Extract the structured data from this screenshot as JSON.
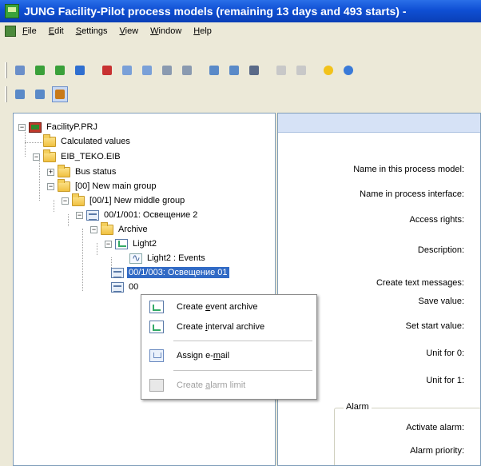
{
  "window": {
    "title": "JUNG Facility-Pilot process models (remaining 13 days and 493 starts) -",
    "icon": "app-icon"
  },
  "menu": {
    "items": [
      {
        "label": "File",
        "underline": "F",
        "rest": "ile"
      },
      {
        "label": "Edit",
        "underline": "E",
        "rest": "dit"
      },
      {
        "label": "Settings",
        "underline": "S",
        "rest": "ettings"
      },
      {
        "label": "View",
        "underline": "V",
        "rest": "iew"
      },
      {
        "label": "Window",
        "underline": "W",
        "rest": "indow"
      },
      {
        "label": "Help",
        "underline": "H",
        "rest": "elp"
      }
    ]
  },
  "toolbar1": {
    "buttons": [
      {
        "name": "properties-icon",
        "color": "#6b8fc9"
      },
      {
        "name": "flag-green-icon",
        "color": "#3aa03a"
      },
      {
        "name": "connect-icon",
        "color": "#3aa03a"
      },
      {
        "name": "save-icon",
        "color": "#2f6fd0",
        "sep": true
      },
      {
        "name": "delete-red-icon",
        "color": "#c83232"
      },
      {
        "name": "chart-icon",
        "color": "#7aa0d8"
      },
      {
        "name": "interval-chart-icon",
        "color": "#7aa0d8"
      },
      {
        "name": "grid-icon",
        "color": "#8a9ab0"
      },
      {
        "name": "calendar-icon",
        "color": "#8a9ab0",
        "sep": true
      },
      {
        "name": "mail-icon",
        "color": "#5a8ac8"
      },
      {
        "name": "mail-sync-icon",
        "color": "#5a8ac8"
      },
      {
        "name": "mail-alarm-icon",
        "color": "#5a6a88",
        "sep": true
      },
      {
        "name": "copy-icon",
        "color": "#c8c8c8"
      },
      {
        "name": "paste-icon",
        "color": "#c8c8c8",
        "sep": true
      },
      {
        "name": "info-icon",
        "color": "#f2c21a",
        "round": true
      },
      {
        "name": "help-icon",
        "color": "#3a7ad8",
        "round": true
      }
    ]
  },
  "toolbar2": {
    "buttons": [
      {
        "name": "tree-view-icon",
        "color": "#5a8ac8"
      },
      {
        "name": "list-view-icon",
        "color": "#5a8ac8"
      },
      {
        "name": "monitor-view-icon",
        "color": "#c87a1a",
        "pressed": true
      }
    ]
  },
  "tree": {
    "project": "FacilityP.PRJ",
    "calculated": "Calculated values",
    "eib": "EIB_TEKO.EIB",
    "bus_status": "Bus status",
    "main_group": "[00] New main group",
    "middle_group": "[00/1] New middle group",
    "device1": "00/1/001: Освещение 2",
    "archive": "Archive",
    "light2": "Light2",
    "light2_events": "Light2 : Events",
    "device2": "00/1/003: Освещение 01",
    "device3": "00"
  },
  "properties": {
    "labels": [
      "Name in this process model:",
      "Name in process interface:",
      "Access rights:",
      "Description:",
      "Create text messages:",
      "Save value:",
      "Set start value:",
      "Unit for 0:",
      "Unit for 1:"
    ],
    "alarm_group": "Alarm",
    "alarm_labels": [
      "Activate alarm:",
      "Alarm priority:"
    ]
  },
  "context_menu": {
    "items": [
      {
        "label": "Create event archive",
        "pre": "Create ",
        "u": "e",
        "post": "vent archive",
        "icon": "event-archive-icon",
        "disabled": false
      },
      {
        "label": "Create interval archive",
        "pre": "Create ",
        "u": "i",
        "post": "nterval archive",
        "icon": "interval-archive-icon",
        "disabled": false
      },
      {
        "label": "Assign e-mail",
        "pre": "Assign e-",
        "u": "m",
        "post": "ail",
        "icon": "email-icon",
        "disabled": false
      },
      {
        "label": "Create alarm limit",
        "pre": "Create ",
        "u": "a",
        "post": "larm limit",
        "icon": "alarm-limit-icon",
        "disabled": true
      }
    ]
  }
}
